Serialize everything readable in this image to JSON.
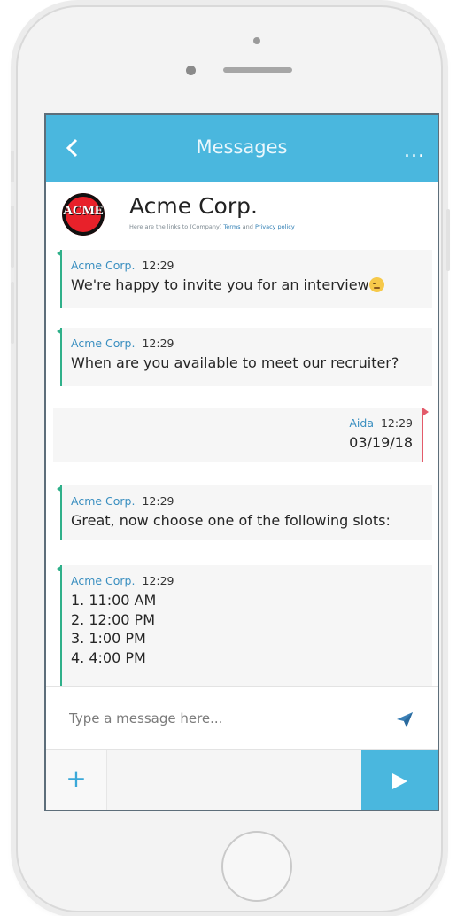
{
  "app": {
    "topbar": {
      "title": "Messages",
      "more_label": "..."
    },
    "company": {
      "logo_text": "ACME",
      "name": "Acme Corp.",
      "links_prefix": "Here are the links to (Company)",
      "terms_link": "Terms",
      "and_text": "and",
      "privacy_link": "Privacy policy"
    },
    "messages": [
      {
        "direction": "in",
        "sender": "Acme Corp.",
        "time": "12:29",
        "lines": [
          "We're happy to invite you for an interview"
        ],
        "emoji": "wink"
      },
      {
        "direction": "in",
        "sender": "Acme Corp.",
        "time": "12:29",
        "lines": [
          "When are you available to meet our recruiter?"
        ]
      },
      {
        "direction": "out",
        "sender": "Aida",
        "time": "12:29",
        "lines": [
          "03/19/18"
        ]
      },
      {
        "direction": "in",
        "sender": "Acme Corp.",
        "time": "12:29",
        "lines": [
          "Great, now choose one of the following slots:"
        ]
      },
      {
        "direction": "in",
        "sender": "Acme Corp.",
        "time": "12:29",
        "lines": [
          "1. 11:00 AM",
          "2. 12:00 PM",
          "3. 1:00 PM",
          "4. 4:00 PM"
        ]
      }
    ],
    "composer": {
      "placeholder": "Type a message here..."
    },
    "bottom": {
      "plus_label": "+"
    }
  },
  "colors": {
    "accent": "#4ab7de",
    "incoming_bar": "#2fb08a",
    "outgoing_bar": "#e35a6a",
    "sender_name": "#3a8fc0",
    "logo_red": "#e8212a"
  },
  "icons": {
    "back": "chevron-left-icon",
    "send": "paper-plane-icon",
    "submit": "play-arrow-icon",
    "add": "plus-icon"
  }
}
